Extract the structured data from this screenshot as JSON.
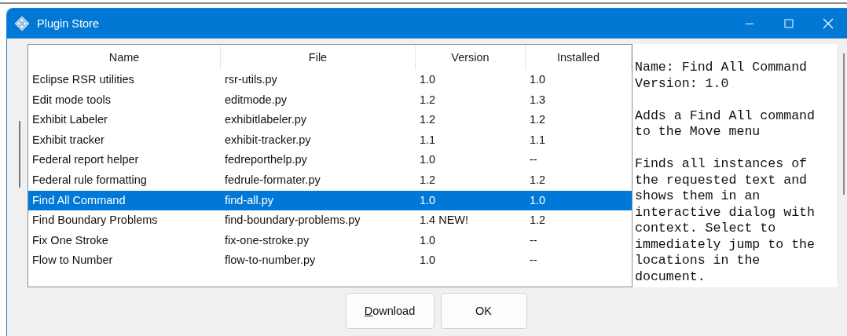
{
  "window": {
    "title": "Plugin Store"
  },
  "table": {
    "columns": [
      "Name",
      "File",
      "Version",
      "Installed"
    ],
    "rows": [
      {
        "cells": [
          "Eclipse RSR utilities",
          "rsr-utils.py",
          "1.0",
          "1.0"
        ],
        "selected": false
      },
      {
        "cells": [
          "Edit mode tools",
          "editmode.py",
          "1.2",
          "1.3"
        ],
        "selected": false
      },
      {
        "cells": [
          "Exhibit Labeler",
          "exhibitlabeler.py",
          "1.2",
          "1.2"
        ],
        "selected": false
      },
      {
        "cells": [
          "Exhibit tracker",
          "exhibit-tracker.py",
          "1.1",
          "1.1"
        ],
        "selected": false
      },
      {
        "cells": [
          "Federal report helper",
          "fedreporthelp.py",
          "1.0",
          "--"
        ],
        "selected": false
      },
      {
        "cells": [
          "Federal rule formatting",
          "fedrule-formater.py",
          "1.2",
          "1.2"
        ],
        "selected": false
      },
      {
        "cells": [
          "Find All Command",
          "find-all.py",
          "1.0",
          "1.0"
        ],
        "selected": true
      },
      {
        "cells": [
          "Find Boundary Problems",
          "find-boundary-problems.py",
          "1.4 NEW!",
          "1.2"
        ],
        "selected": false
      },
      {
        "cells": [
          "Fix One Stroke",
          "fix-one-stroke.py",
          "1.0",
          "--"
        ],
        "selected": false
      },
      {
        "cells": [
          "Flow to Number",
          "flow-to-number.py",
          "1.0",
          "--"
        ],
        "selected": false
      }
    ]
  },
  "details": {
    "paragraphs": [
      [
        "Name: Find All Command",
        "Version: 1.0"
      ],
      [
        "Adds a Find All command to the Move menu"
      ],
      [
        "Finds all instances of the requested text and shows them in an interactive dialog with context. Select to immediately jump to the locations in the document."
      ]
    ]
  },
  "buttons": [
    {
      "label": "Download",
      "mnemonic_underlined": true
    },
    {
      "label": "OK",
      "mnemonic_underlined": false
    }
  ]
}
